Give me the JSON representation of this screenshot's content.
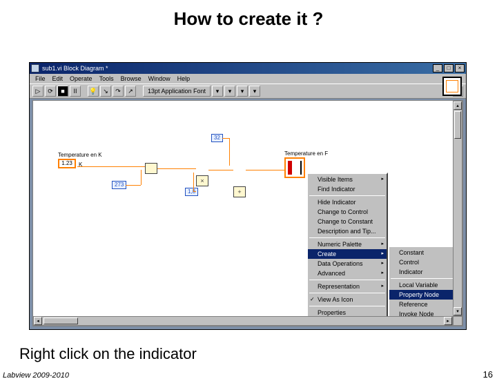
{
  "slide": {
    "title": "How to create it ?",
    "instruction": "Right click on the indicator",
    "footer_left": "Labview 2009-2010",
    "footer_right": "16"
  },
  "window": {
    "title": "sub1.vi Block Diagram *",
    "buttons": {
      "min": "_",
      "max": "□",
      "close": "×"
    },
    "menu": [
      "File",
      "Edit",
      "Operate",
      "Tools",
      "Browse",
      "Window",
      "Help"
    ],
    "toolbar": {
      "run": "▷",
      "runc": "⟳",
      "stop": "■",
      "pause": "II",
      "bulb": "💡",
      "step_in": "↘",
      "step_over": "↷",
      "step_out": "↗",
      "font": "13pt Application Font",
      "aligns": [
        "▾",
        "▾",
        "▾",
        "▾"
      ],
      "help_icon": "?"
    }
  },
  "diagram": {
    "input_label": "Temperature en K",
    "input_val": "1.23",
    "unit_suffix": "K",
    "const_273": "273",
    "const_32": "32",
    "const_1_8": "1,8",
    "output_label": "Temperature en F"
  },
  "menu1": {
    "items": [
      {
        "label": "Visible Items",
        "arrow": true
      },
      {
        "label": "Find Indicator"
      },
      {
        "sep": true
      },
      {
        "label": "Hide Indicator"
      },
      {
        "label": "Change to Control"
      },
      {
        "label": "Change to Constant"
      },
      {
        "label": "Description and Tip..."
      },
      {
        "sep": true
      },
      {
        "label": "Numeric Palette",
        "arrow": true
      },
      {
        "label": "Create",
        "arrow": true,
        "sel": true
      },
      {
        "label": "Data Operations",
        "arrow": true
      },
      {
        "label": "Advanced",
        "arrow": true
      },
      {
        "sep": true
      },
      {
        "label": "Representation",
        "arrow": true
      },
      {
        "sep": true
      },
      {
        "label": "View As Icon",
        "check": true
      },
      {
        "sep": true
      },
      {
        "label": "Properties"
      }
    ]
  },
  "menu2": {
    "items": [
      {
        "label": "Constant"
      },
      {
        "label": "Control"
      },
      {
        "label": "Indicator"
      },
      {
        "sep": true
      },
      {
        "label": "Local Variable"
      },
      {
        "label": "Property Node",
        "sel": true
      },
      {
        "label": "Reference"
      },
      {
        "label": "Invoke Node"
      }
    ]
  }
}
